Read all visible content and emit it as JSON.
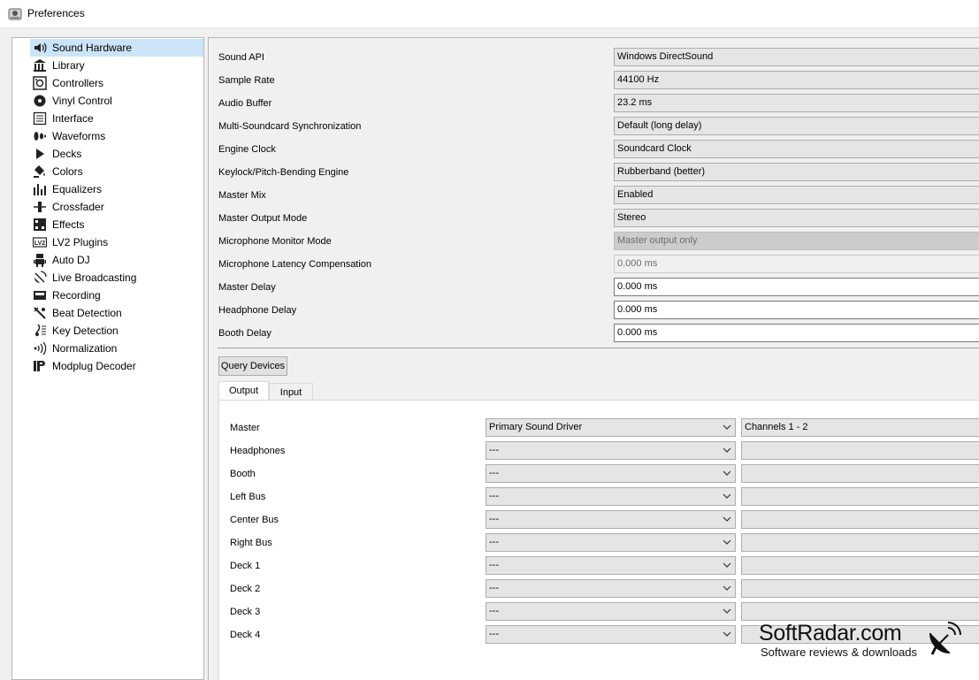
{
  "window": {
    "title": "Preferences"
  },
  "sidebar": {
    "items": [
      {
        "label": "Sound Hardware",
        "icon": "speaker-icon",
        "selected": true
      },
      {
        "label": "Library",
        "icon": "library-icon"
      },
      {
        "label": "Controllers",
        "icon": "controller-icon"
      },
      {
        "label": "Vinyl Control",
        "icon": "vinyl-icon"
      },
      {
        "label": "Interface",
        "icon": "interface-icon"
      },
      {
        "label": "Waveforms",
        "icon": "waveform-icon"
      },
      {
        "label": "Decks",
        "icon": "play-icon"
      },
      {
        "label": "Colors",
        "icon": "paint-bucket-icon"
      },
      {
        "label": "Equalizers",
        "icon": "equalizer-icon"
      },
      {
        "label": "Crossfader",
        "icon": "crossfader-icon"
      },
      {
        "label": "Effects",
        "icon": "effects-icon"
      },
      {
        "label": "LV2 Plugins",
        "icon": "lv2-icon"
      },
      {
        "label": "Auto DJ",
        "icon": "robot-icon"
      },
      {
        "label": "Live Broadcasting",
        "icon": "satellite-icon"
      },
      {
        "label": "Recording",
        "icon": "recording-icon"
      },
      {
        "label": "Beat Detection",
        "icon": "beat-detection-icon"
      },
      {
        "label": "Key Detection",
        "icon": "key-detection-icon"
      },
      {
        "label": "Normalization",
        "icon": "normalization-icon"
      },
      {
        "label": "Modplug Decoder",
        "icon": "modplug-icon"
      }
    ]
  },
  "settings": {
    "rows": [
      {
        "label": "Sound API",
        "value": "Windows DirectSound",
        "kind": "combo"
      },
      {
        "label": "Sample Rate",
        "value": "44100 Hz",
        "kind": "combo"
      },
      {
        "label": "Audio Buffer",
        "value": "23.2 ms",
        "kind": "combo"
      },
      {
        "label": "Multi-Soundcard Synchronization",
        "value": "Default (long delay)",
        "kind": "combo"
      },
      {
        "label": "Engine Clock",
        "value": "Soundcard Clock",
        "kind": "combo"
      },
      {
        "label": "Keylock/Pitch-Bending Engine",
        "value": "Rubberband (better)",
        "kind": "combo"
      },
      {
        "label": "Master Mix",
        "value": "Enabled",
        "kind": "combo"
      },
      {
        "label": "Master Output Mode",
        "value": "Stereo",
        "kind": "combo"
      },
      {
        "label": "Microphone Monitor Mode",
        "value": "Master output only",
        "kind": "combo-disabled"
      },
      {
        "label": "Microphone Latency Compensation",
        "value": "0.000 ms",
        "kind": "edit-disabled"
      },
      {
        "label": "Master Delay",
        "value": "0.000 ms",
        "kind": "edit"
      },
      {
        "label": "Headphone Delay",
        "value": "0.000 ms",
        "kind": "edit"
      },
      {
        "label": "Booth Delay",
        "value": "0.000 ms",
        "kind": "edit"
      }
    ]
  },
  "query_button": {
    "label": "Query Devices"
  },
  "tabs": [
    {
      "label": "Output",
      "active": true
    },
    {
      "label": "Input",
      "active": false
    }
  ],
  "outputs": [
    {
      "label": "Master",
      "device": "Primary Sound Driver",
      "channels": "Channels 1 - 2"
    },
    {
      "label": "Headphones",
      "device": "---",
      "channels": ""
    },
    {
      "label": "Booth",
      "device": "---",
      "channels": ""
    },
    {
      "label": "Left Bus",
      "device": "---",
      "channels": ""
    },
    {
      "label": "Center Bus",
      "device": "---",
      "channels": ""
    },
    {
      "label": "Right Bus",
      "device": "---",
      "channels": ""
    },
    {
      "label": "Deck 1",
      "device": "---",
      "channels": ""
    },
    {
      "label": "Deck 2",
      "device": "---",
      "channels": ""
    },
    {
      "label": "Deck 3",
      "device": "---",
      "channels": ""
    },
    {
      "label": "Deck 4",
      "device": "---",
      "channels": ""
    }
  ],
  "watermark": {
    "main": "SoftRadar.com",
    "sub": "Software reviews & downloads"
  },
  "colors": {
    "selection": "#cce4f7",
    "combo_bg": "#e5e5e5",
    "border": "#adadad"
  }
}
